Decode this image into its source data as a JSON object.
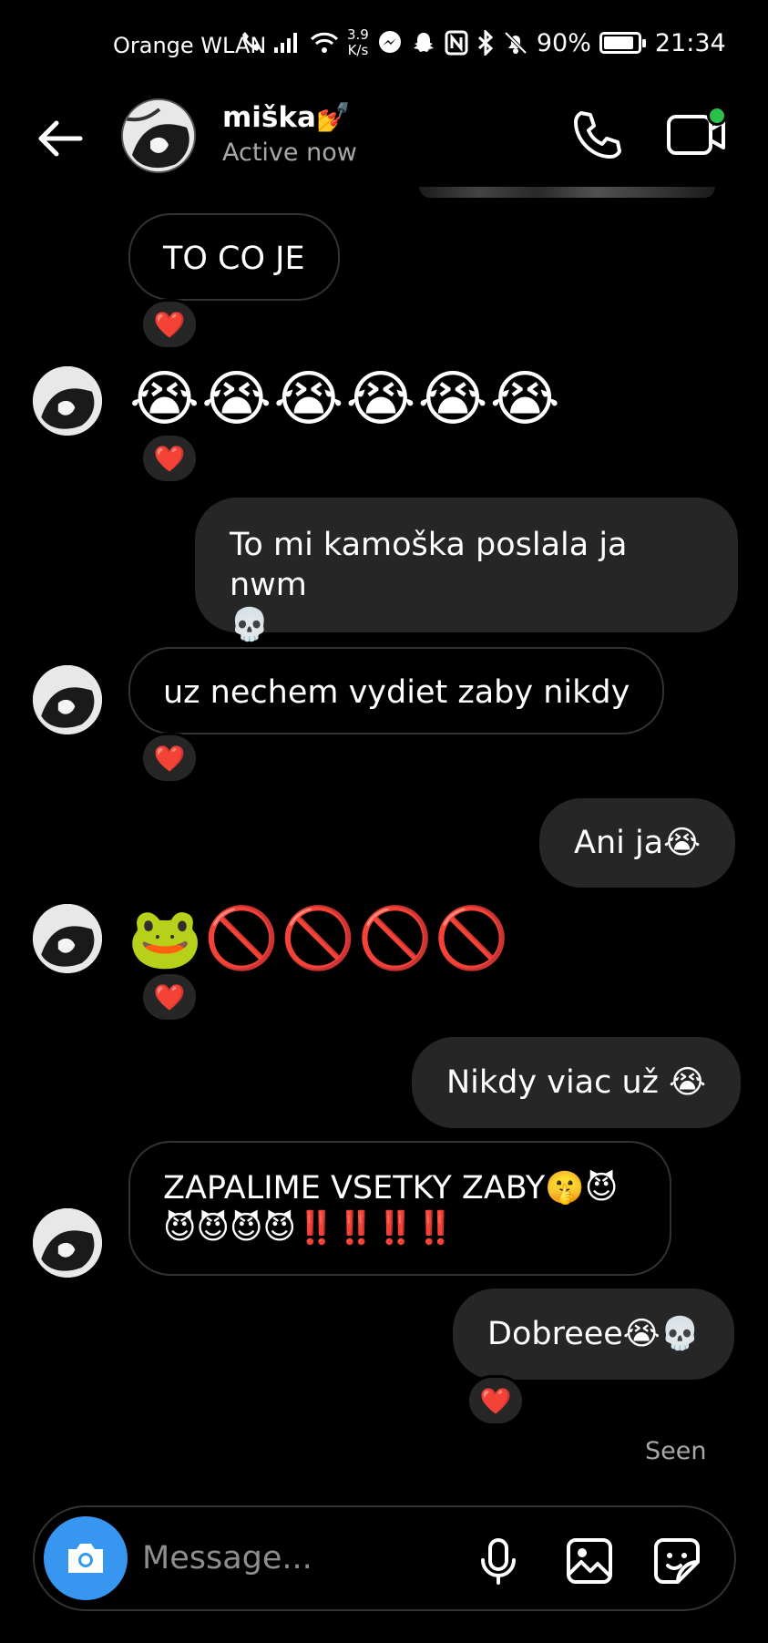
{
  "status_bar": {
    "carrier": "Orange WLAN",
    "speed_value": "3.9",
    "speed_unit": "K/s",
    "battery": "90%",
    "battery_level": 0.9,
    "time": "21:34",
    "icons": [
      "wifi-call-icon",
      "signal-icon",
      "wifi-icon",
      "messenger-icon",
      "snapchat-icon",
      "nfc-icon",
      "bluetooth-icon",
      "mute-icon",
      "battery-icon"
    ]
  },
  "header": {
    "contact_name": "miška",
    "name_emoji": "💅",
    "status": "Active now",
    "icons": [
      "back-arrow-icon",
      "phone-icon",
      "video-call-icon"
    ],
    "online_color": "#2ac04a"
  },
  "messages": [
    {
      "side": "in",
      "text": "TO CO JE",
      "reaction": "❤️"
    },
    {
      "side": "in",
      "text": "😭😭😭😭😭😭",
      "emoji_only": true,
      "reaction": "❤️"
    },
    {
      "side": "out",
      "text_line1": "To mi kamoška poslala ja nwm",
      "text_line2": "💀"
    },
    {
      "side": "in",
      "text": "uz nechem vydiet zaby nikdy",
      "reaction": "❤️"
    },
    {
      "side": "out",
      "text": "Ani ja😭"
    },
    {
      "side": "in",
      "text": "🐸🚫🚫🚫🚫",
      "emoji_only": true,
      "reaction": "❤️"
    },
    {
      "side": "out",
      "text": "Nikdy viac už 😭"
    },
    {
      "side": "in",
      "text_line1": "ZAPALIME VSETKY ZABY🤫😈",
      "text_line2": "😈😈😈😈‼️‼️‼️‼️"
    },
    {
      "side": "out",
      "text": "Dobreee😭💀",
      "reaction": "❤️"
    }
  ],
  "seen": "Seen",
  "composer": {
    "placeholder": "Message...",
    "icons": [
      "camera-icon",
      "microphone-icon",
      "gallery-icon",
      "sticker-icon"
    ],
    "camera_color": "#3797f0"
  },
  "colors": {
    "background": "#000000",
    "outgoing_bubble": "#262626",
    "incoming_border": "#333333",
    "reaction": "#e41e3f",
    "secondary_text": "#a8a8a8"
  }
}
